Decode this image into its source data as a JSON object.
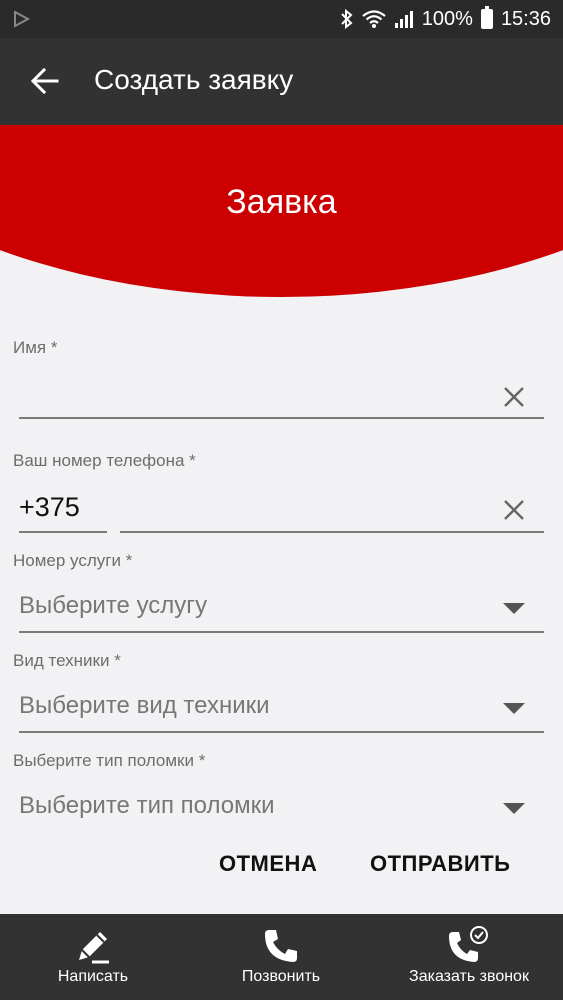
{
  "status_bar": {
    "battery": "100%",
    "time": "15:36"
  },
  "app_bar": {
    "title": "Создать заявку"
  },
  "hero": {
    "title": "Заявка"
  },
  "form": {
    "name": {
      "label": "Имя *",
      "value": ""
    },
    "phone": {
      "label": "Ваш номер телефона *",
      "prefix": "+375",
      "value": ""
    },
    "service": {
      "label": "Номер услуги *",
      "placeholder": "Выберите услугу"
    },
    "equipment": {
      "label": "Вид техники *",
      "placeholder": "Выберите вид техники"
    },
    "breakdown": {
      "label": "Выберите тип поломки *",
      "placeholder": "Выберите тип поломки"
    },
    "cancel_label": "ОТМЕНА",
    "submit_label": "ОТПРАВИТЬ"
  },
  "bottom_nav": {
    "items": [
      {
        "label": "Написать",
        "icon": "pencil-icon"
      },
      {
        "label": "Позвонить",
        "icon": "phone-icon"
      },
      {
        "label": "Заказать звонок",
        "icon": "phone-check-icon"
      }
    ]
  },
  "colors": {
    "accent_red": "#cc0000",
    "bar_dark": "#323232",
    "background": "#f2f2f4"
  }
}
